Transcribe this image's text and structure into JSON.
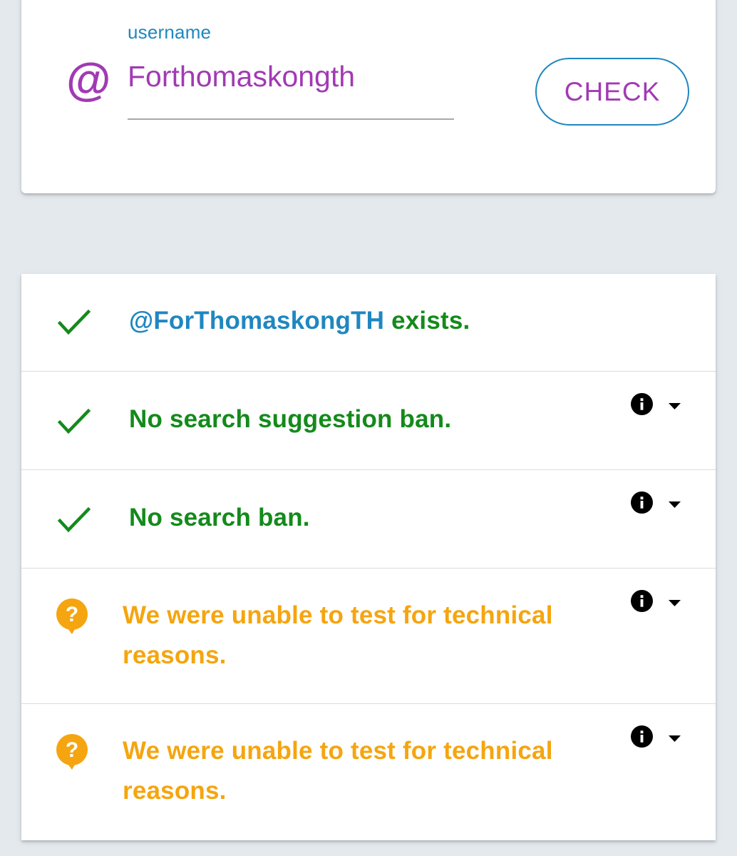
{
  "search": {
    "label": "username",
    "at_symbol": "@",
    "value": "Forthomaskongth",
    "check_label": "CHECK"
  },
  "results": [
    {
      "status": "ok",
      "icon": "checkmark-icon",
      "handle": "@ForThomaskongTH",
      "text": " exists.",
      "has_info": false
    },
    {
      "status": "ok",
      "icon": "checkmark-icon",
      "text": "No search suggestion ban.",
      "has_info": true
    },
    {
      "status": "ok",
      "icon": "checkmark-icon",
      "text": "No search ban.",
      "has_info": true
    },
    {
      "status": "unknown",
      "icon": "question-bubble-icon",
      "text_line1": "We were unable to test for technical",
      "text_line2": "reasons.",
      "has_info": true
    },
    {
      "status": "unknown",
      "icon": "question-bubble-icon",
      "text_line1": "We were unable to test for technical",
      "text_line2": "reasons.",
      "has_info": true
    }
  ],
  "colors": {
    "accent_purple": "#a13ab4",
    "accent_blue": "#1f87c0",
    "success_green": "#148a1b",
    "warning_orange": "#f5a50f",
    "background": "#e4e9ee"
  }
}
